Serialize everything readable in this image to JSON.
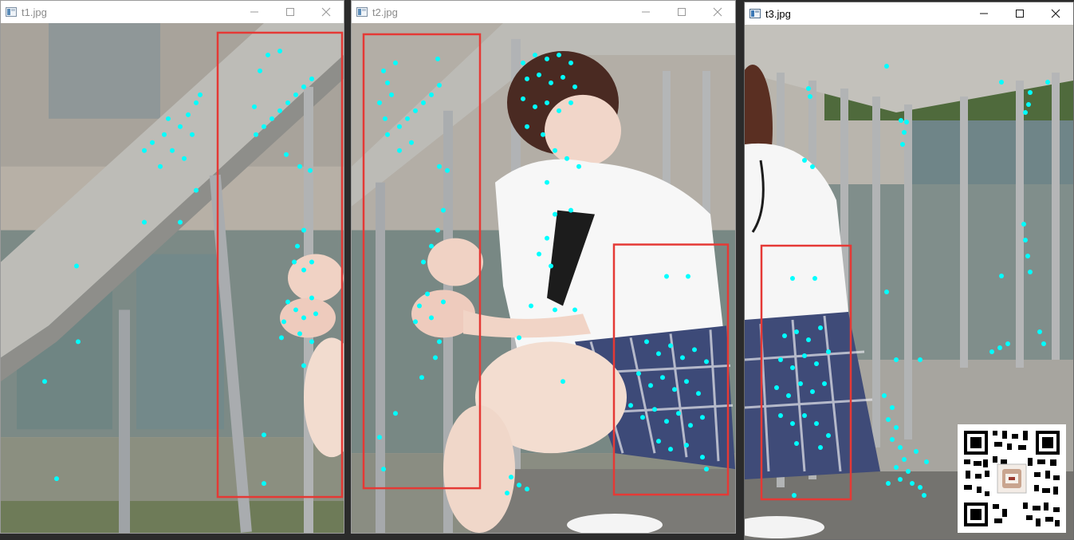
{
  "windows": [
    {
      "title": "t1.jpg",
      "state": "inactive"
    },
    {
      "title": "t2.jpg",
      "state": "inactive"
    },
    {
      "title": "t3.jpg",
      "state": "active"
    }
  ],
  "colors": {
    "keypoint": "#00ffff",
    "match_box": "#e53935",
    "titlebar": "#ffffff"
  },
  "icons": {
    "window": "image-viewer-icon",
    "minimize": "minimize-icon",
    "maximize": "maximize-icon",
    "close": "close-icon",
    "qr": "qr-code"
  }
}
